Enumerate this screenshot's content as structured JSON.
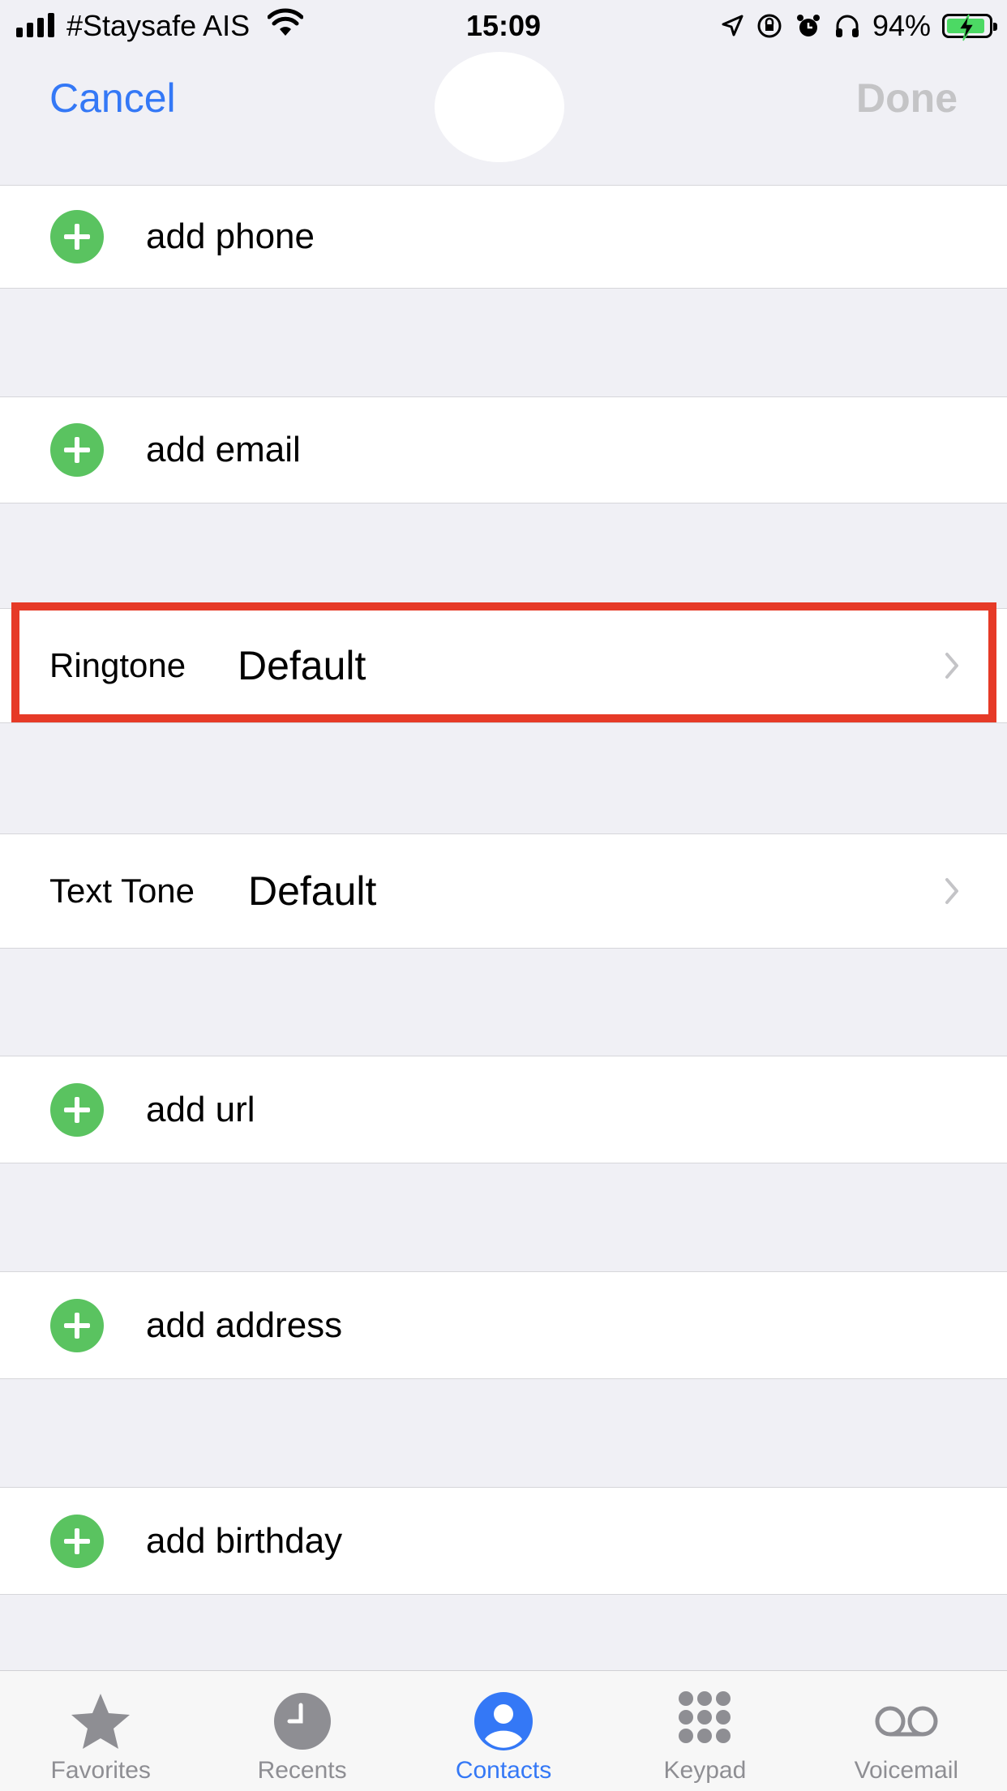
{
  "status_bar": {
    "carrier": "#Staysafe AIS",
    "time": "15:09",
    "battery_percent": "94%",
    "battery_level": 0.94,
    "icons": [
      "signal-icon",
      "wifi-icon",
      "location-icon",
      "orientation-lock-icon",
      "alarm-icon",
      "headphones-icon",
      "battery-charging-icon"
    ]
  },
  "nav": {
    "cancel_label": "Cancel",
    "done_label": "Done"
  },
  "rows": {
    "add_phone": "add phone",
    "add_email": "add email",
    "ringtone_label": "Ringtone",
    "ringtone_value": "Default",
    "text_tone_label": "Text Tone",
    "text_tone_value": "Default",
    "add_url": "add url",
    "add_address": "add address",
    "add_birthday": "add birthday"
  },
  "tabs": [
    {
      "label": "Favorites",
      "icon": "star-icon"
    },
    {
      "label": "Recents",
      "icon": "clock-icon"
    },
    {
      "label": "Contacts",
      "icon": "person-icon"
    },
    {
      "label": "Keypad",
      "icon": "keypad-icon"
    },
    {
      "label": "Voicemail",
      "icon": "voicemail-icon"
    }
  ],
  "colors": {
    "accent": "#3478f6",
    "add_green": "#5ac360",
    "highlight_red": "#e63a27",
    "done_disabled": "#c4c4c6",
    "background": "#f0f0f5"
  }
}
